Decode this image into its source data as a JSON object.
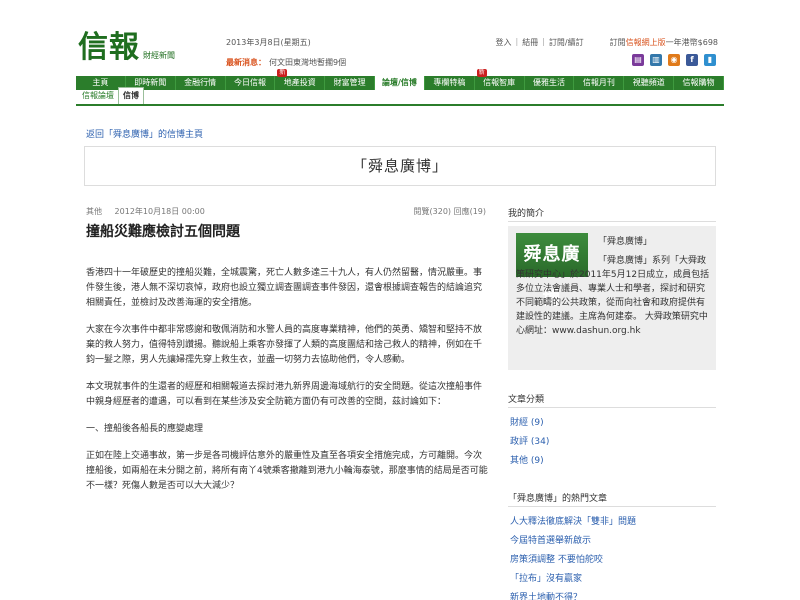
{
  "header": {
    "logo_main": "信報",
    "logo_sub": "財經新聞",
    "date": "2013年3月8日(星期五)",
    "news_label": "最新消息：",
    "news_text": "何文田東灣地暫擱9個",
    "top_links": [
      "登入",
      "結冊",
      "訂閱/續訂"
    ],
    "subscribe_text": "訂閱",
    "subscribe_highlight": "信報網上版",
    "subscribe_price": "一年港幣$698",
    "social_icons": [
      {
        "name": "calendar-icon",
        "glyph": "▤",
        "color": "#7a3a9a"
      },
      {
        "name": "page-icon",
        "glyph": "▥",
        "color": "#3377aa"
      },
      {
        "name": "rss-icon",
        "glyph": "◉",
        "color": "#e07a1a"
      },
      {
        "name": "facebook-icon",
        "glyph": "f",
        "color": "#3b5998"
      },
      {
        "name": "mobile-icon",
        "glyph": "▮",
        "color": "#2f8fcf"
      }
    ]
  },
  "nav": {
    "items": [
      {
        "label": "主頁",
        "new": false,
        "active": false
      },
      {
        "label": "即時新聞",
        "new": false,
        "active": false
      },
      {
        "label": "金融行情",
        "new": false,
        "active": false
      },
      {
        "label": "今日信報",
        "new": false,
        "active": false
      },
      {
        "label": "地產投資",
        "new": true,
        "active": false
      },
      {
        "label": "財富管理",
        "new": false,
        "active": false
      },
      {
        "label": "論壇/信博",
        "new": false,
        "active": true
      },
      {
        "label": "專欄特稿",
        "new": false,
        "active": false
      },
      {
        "label": "信報智庫",
        "new": true,
        "active": false
      },
      {
        "label": "優雅生活",
        "new": false,
        "active": false
      },
      {
        "label": "信報月刊",
        "new": false,
        "active": false
      },
      {
        "label": "視聽頻道",
        "new": false,
        "active": false
      },
      {
        "label": "信報購物",
        "new": false,
        "active": false
      }
    ],
    "new_badge": "新",
    "sub_items": [
      {
        "label": "信報論壇",
        "active": false
      },
      {
        "label": "信博",
        "active": true
      }
    ]
  },
  "blog": {
    "back_link": "返回「舜息廣博」的信博主頁",
    "name": "「舜息廣博」"
  },
  "post": {
    "category": "其他",
    "datetime": "2012年10月18日 00:00",
    "stats": "閱覽(320)  回應(19)",
    "title": "撞船災難應檢討五個問題",
    "paragraphs": [
      "香港四十一年破歷史的撞船災難，全城震驚，死亡人數多達三十九人，有人仍然留醫，情況嚴重。事件發生後，港人無不深切哀悼，政府也設立獨立調查團調查事件發因，還會根據調查報告的結論追究相關責任，並檢討及改善海運的安全措施。",
      "大家在今次事件中都非常感謝和敬佩消防和水警人員的高度專業精神，他們的英勇、矯智和堅持不放棄的救人努力，值得特別讚揚。聽說船上乘客亦發揮了人類的高度團結和捨己救人的精神，例如在千鈞一髮之際，男人先讓婦孺先穿上救生衣，並盡一切努力去協助他們，令人感動。",
      "本文現就事件的生還者的經歷和相關報道去探討港九新界周邊海域航行的安全問題。從這次撞船事件中親身經歷者的遭遇，可以看到在某些涉及安全防範方面仍有可改善的空間，茲討論如下：",
      "一、撞船後各船長的應變處理",
      "正如在陸上交通事故，第一步是各司機評估意外的嚴重性及直至各項安全措施完成，方可離開。今次撞船後，如兩船在未分開之前，將所有南丫4號乘客撤離到港九小輪海泰號，那麼事情的結局是否可能不一樣？死傷人數是否可以大大減少？"
    ]
  },
  "sidebar": {
    "profile_heading": "我的簡介",
    "profile_image_text": "舜息廣博",
    "profile_name": "「舜息廣博」",
    "profile_desc": "「舜息廣博」系列「大舜政策研究中心」於2011年5月12日成立，成員包括多位立法會議員、專業人士和學者，探討和研究不同範疇的公共政策，從而向社會和政府提供有建設性的建議。主席為何建泰。 大舜政策研究中心網址：www.dashun.org.hk",
    "categories_heading": "文章分類",
    "categories": [
      "財經 (9)",
      "政評 (34)",
      "其他 (9)"
    ],
    "hot_heading": "「舜息廣博」的熱門文章",
    "hot_articles": [
      "人大釋法徹底解決「雙非」問題",
      "今屆特首選舉新啟示",
      "房策須調整 不要怕舵咬",
      "「拉布」沒有贏家",
      "新界土地動不得？"
    ]
  }
}
